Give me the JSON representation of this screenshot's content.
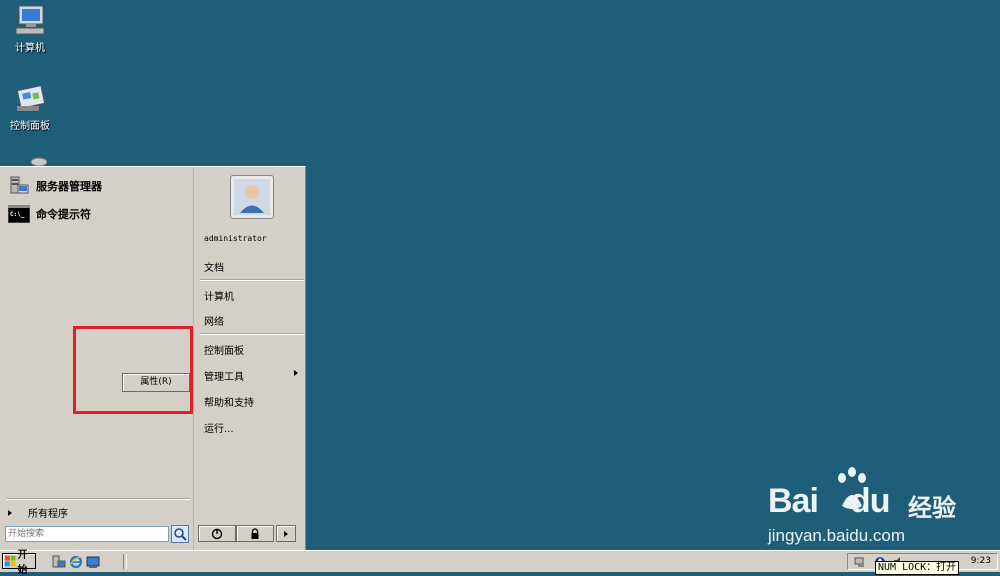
{
  "desktop": {
    "icons": [
      {
        "label": "计算机",
        "icon": "computer-icon"
      },
      {
        "label": "控制面板",
        "icon": "control-panel-icon"
      },
      {
        "label": "",
        "icon": "recycle-bin-icon"
      }
    ]
  },
  "start_menu": {
    "pinned": [
      {
        "label": "服务器管理器",
        "icon": "server-manager-icon"
      },
      {
        "label": "命令提示符",
        "icon": "command-prompt-icon"
      }
    ],
    "context_menu": {
      "label": "属性(R)"
    },
    "all_programs": "所有程序",
    "search": {
      "placeholder": "开始搜索"
    },
    "user": {
      "name": "administrator",
      "icon": "user-avatar-icon"
    },
    "right_items": {
      "documents": "文档",
      "computer": "计算机",
      "network": "网络",
      "control_panel": "控制面板",
      "admin_tools": "管理工具",
      "help": "帮助和支持",
      "run": "运行..."
    },
    "buttons": {
      "power_icon": "power-icon",
      "lock_icon": "lock-icon",
      "arrow_icon": "chevron-right-icon"
    }
  },
  "taskbar": {
    "start_label": "开始",
    "quick_launch": [
      "server-manager-icon",
      "ie-icon",
      "show-desktop-icon"
    ],
    "clock": "9:23",
    "numlock_tooltip": "NUM LOCK：打开"
  },
  "watermark": {
    "brand": "Bai",
    "brand_suffix": "du",
    "jingyan": "经验",
    "url": "jingyan.baidu.com"
  },
  "colors": {
    "desktop_bg": "#1f5e78",
    "highlight_box": "#e0202a",
    "menu_bg": "#d4d0c8"
  }
}
